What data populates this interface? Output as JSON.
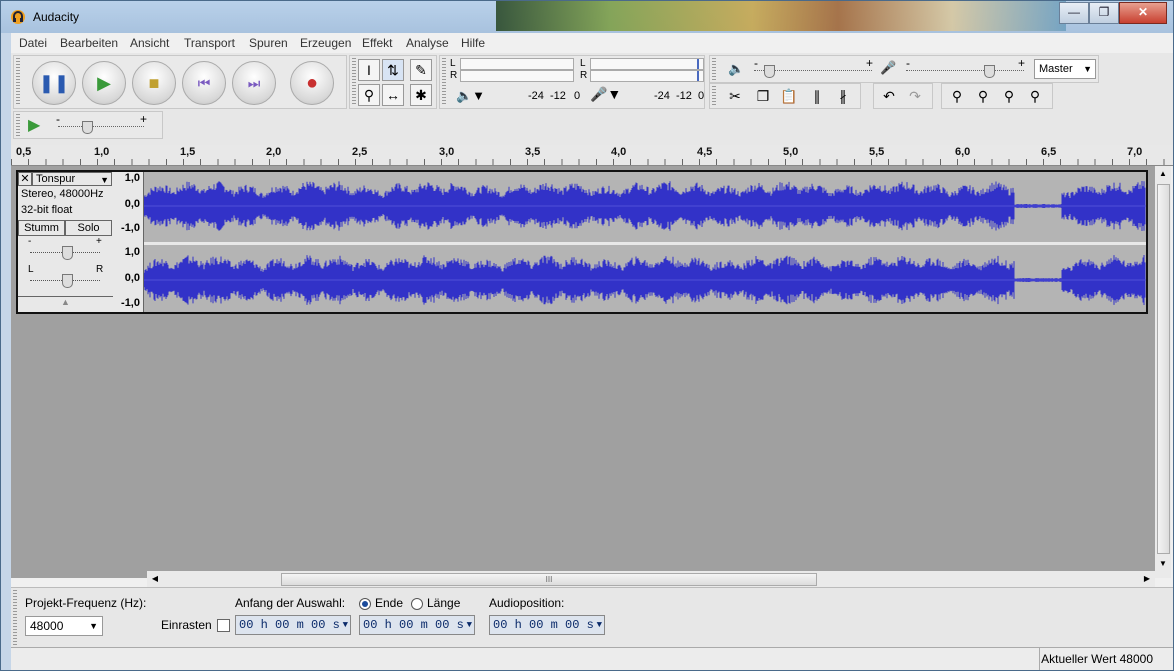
{
  "window": {
    "title": "Audacity"
  },
  "menu": [
    "Datei",
    "Bearbeiten",
    "Ansicht",
    "Transport",
    "Spuren",
    "Erzeugen",
    "Effekt",
    "Analyse",
    "Hilfe"
  ],
  "meters": {
    "left_channel": "L",
    "right_channel": "R",
    "play_scale": [
      "-24",
      "-12",
      "0"
    ],
    "rec_scale": [
      "-24",
      "-12",
      "0"
    ]
  },
  "mixer": {
    "input_source": "Master",
    "minus": "-",
    "plus": "+"
  },
  "ruler": {
    "ticks": [
      "0,5",
      "1,0",
      "1,5",
      "2,0",
      "2,5",
      "3,0",
      "3,5",
      "4,0",
      "4,5",
      "5,0",
      "5,5",
      "6,0",
      "6,5",
      "7,0"
    ]
  },
  "track": {
    "name": "Tonspur",
    "info_line1": "Stereo, 48000Hz",
    "info_line2": "32-bit float",
    "mute": "Stumm",
    "solo": "Solo",
    "gain_minus": "-",
    "gain_plus": "+",
    "pan_left": "L",
    "pan_right": "R",
    "scale": [
      "1,0",
      "0,0",
      "-1,0"
    ]
  },
  "selection": {
    "rate_label": "Projekt-Frequenz (Hz):",
    "rate_value": "48000",
    "snap_label": "Einrasten",
    "start_label": "Anfang der Auswahl:",
    "end_label": "Ende",
    "length_label": "Länge",
    "audio_pos_label": "Audioposition:",
    "start_value": "00 h 00 m 00 s",
    "end_value": "00 h 00 m 00 s",
    "pos_value": "00 h 00 m 00 s",
    "s_suffix": "s"
  },
  "status": {
    "right": "Aktueller Wert 48000"
  },
  "hscroll": {
    "grip": "III"
  },
  "icons": {
    "pause": "pause-icon",
    "play": "play-icon",
    "stop": "stop-icon",
    "skip_start": "skip-start-icon",
    "skip_end": "skip-end-icon",
    "record": "record-icon",
    "select": "select-tool-icon",
    "envelope": "envelope-tool-icon",
    "draw": "draw-tool-icon",
    "zoom": "zoom-tool-icon",
    "timeshift": "timeshift-tool-icon",
    "multi": "multi-tool-icon"
  },
  "colors": {
    "waveform": "#3232c8",
    "track_bg": "#b4b4b4",
    "record": "#c83030",
    "play": "#3a9a3a"
  }
}
